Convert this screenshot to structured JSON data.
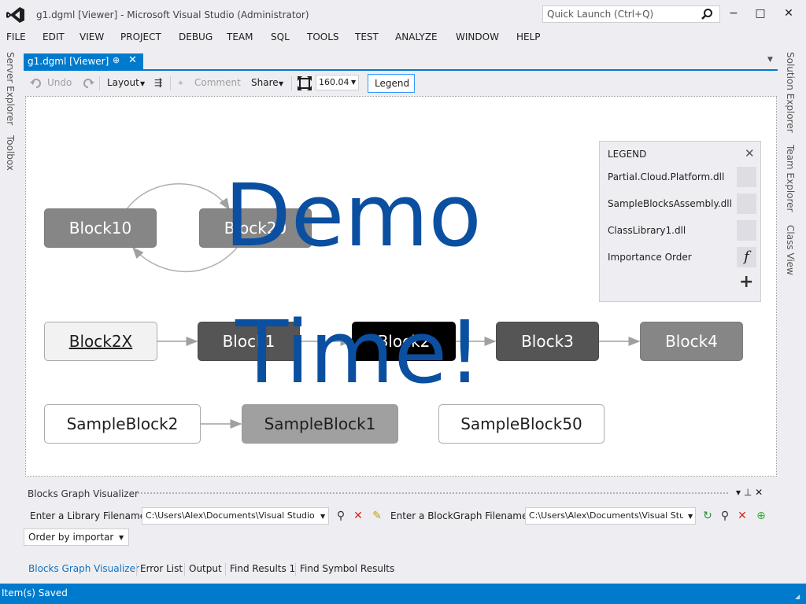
{
  "window": {
    "title": "g1.dgml [Viewer] - Microsoft Visual Studio (Administrator)",
    "quick_launch_placeholder": "Quick Launch (Ctrl+Q)",
    "minimize": "−",
    "maximize": "□",
    "close": "✕"
  },
  "menu": [
    "FILE",
    "EDIT",
    "VIEW",
    "PROJECT",
    "DEBUG",
    "TEAM",
    "SQL",
    "TOOLS",
    "TEST",
    "ANALYZE",
    "WINDOW",
    "HELP"
  ],
  "left_dock": [
    "Server Explorer",
    "Toolbox"
  ],
  "right_dock": [
    "Solution Explorer",
    "Team Explorer",
    "Class View"
  ],
  "doc_tab": {
    "label": "g1.dgml [Viewer]",
    "pin": "⊕",
    "close": "✕"
  },
  "toolbar": {
    "undo": "Undo",
    "layout": "Layout",
    "comment": "Comment",
    "share": "Share",
    "zoom": "160.04",
    "legend": "Legend"
  },
  "graph": {
    "blocks": [
      {
        "id": "block10",
        "label": "Block10"
      },
      {
        "id": "block20",
        "label": "Block20"
      },
      {
        "id": "block2x",
        "label": "Block2X"
      },
      {
        "id": "block1",
        "label": "Block1"
      },
      {
        "id": "block2",
        "label": "Block2"
      },
      {
        "id": "block3",
        "label": "Block3"
      },
      {
        "id": "block4",
        "label": "Block4"
      },
      {
        "id": "sampleblock2",
        "label": "SampleBlock2"
      },
      {
        "id": "sampleblock1",
        "label": "SampleBlock1"
      },
      {
        "id": "sampleblock50",
        "label": "SampleBlock50"
      }
    ]
  },
  "legend": {
    "title": "LEGEND",
    "close": "✕",
    "items": [
      "Partial.Cloud.Platform.dll",
      "SampleBlocksAssembly.dll",
      "ClassLibrary1.dll",
      "Importance Order"
    ],
    "function_symbol": "f",
    "add": "+"
  },
  "overlay": {
    "line1": "Demo",
    "line2": "Time!"
  },
  "tool_window": {
    "title": "Blocks Graph Visualizer",
    "library_label": "Enter a Library Filename",
    "library_value": "C:\\Users\\Alex\\Documents\\Visual Studio",
    "blockgraph_label": "Enter a BlockGraph Filename",
    "blockgraph_value": "C:\\Users\\Alex\\Documents\\Visual Studio",
    "order_value": "Order by importar"
  },
  "bottom_tabs": [
    "Blocks Graph Visualizer",
    "Error List",
    "Output",
    "Find Results 1",
    "Find Symbol Results"
  ],
  "status": {
    "text": "Item(s) Saved"
  },
  "colors": {
    "accent": "#007acc",
    "overlay_text": "#0b4fa0"
  }
}
